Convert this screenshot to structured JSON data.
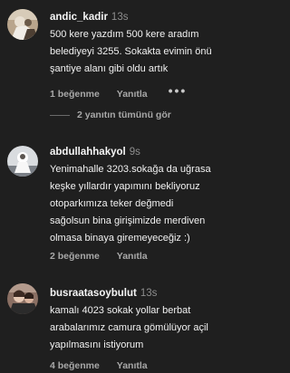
{
  "comments": [
    {
      "username": "andic_kadir",
      "time": "13s",
      "text": "500 kere yazdım 500 kere aradım\nbelediyeyi 3255. Sokakta evimin önü\nşantiye alanı gibi oldu artık",
      "likes": "1 beğenme",
      "reply": "Yanıtla",
      "more": "•••",
      "show_replies": "2 yanıtın tümünü gör"
    },
    {
      "username": "abdullahhakyol",
      "time": "9s",
      "text": "Yenimahalle 3203.sokağa da uğrasa\nkeşke yıllardır yapımını bekliyoruz\notoparkımıza teker değmedi\nsağolsun bina girişimizde merdiven\nolmasa binaya giremeyeceğiz :)",
      "likes": "2 beğenme",
      "reply": "Yanıtla"
    },
    {
      "username": "busraatasoybulut",
      "time": "13s",
      "text": "kamalı 4023 sokak yollar berbat\narabalarımız camura gömülüyor açil\nyapılmasını istiyorum",
      "likes": "4 beğenme",
      "reply": "Yanıtla"
    }
  ],
  "colors": {
    "background": "#1f1f1f",
    "text": "#f2f2f2",
    "muted": "#a8a8a8"
  }
}
